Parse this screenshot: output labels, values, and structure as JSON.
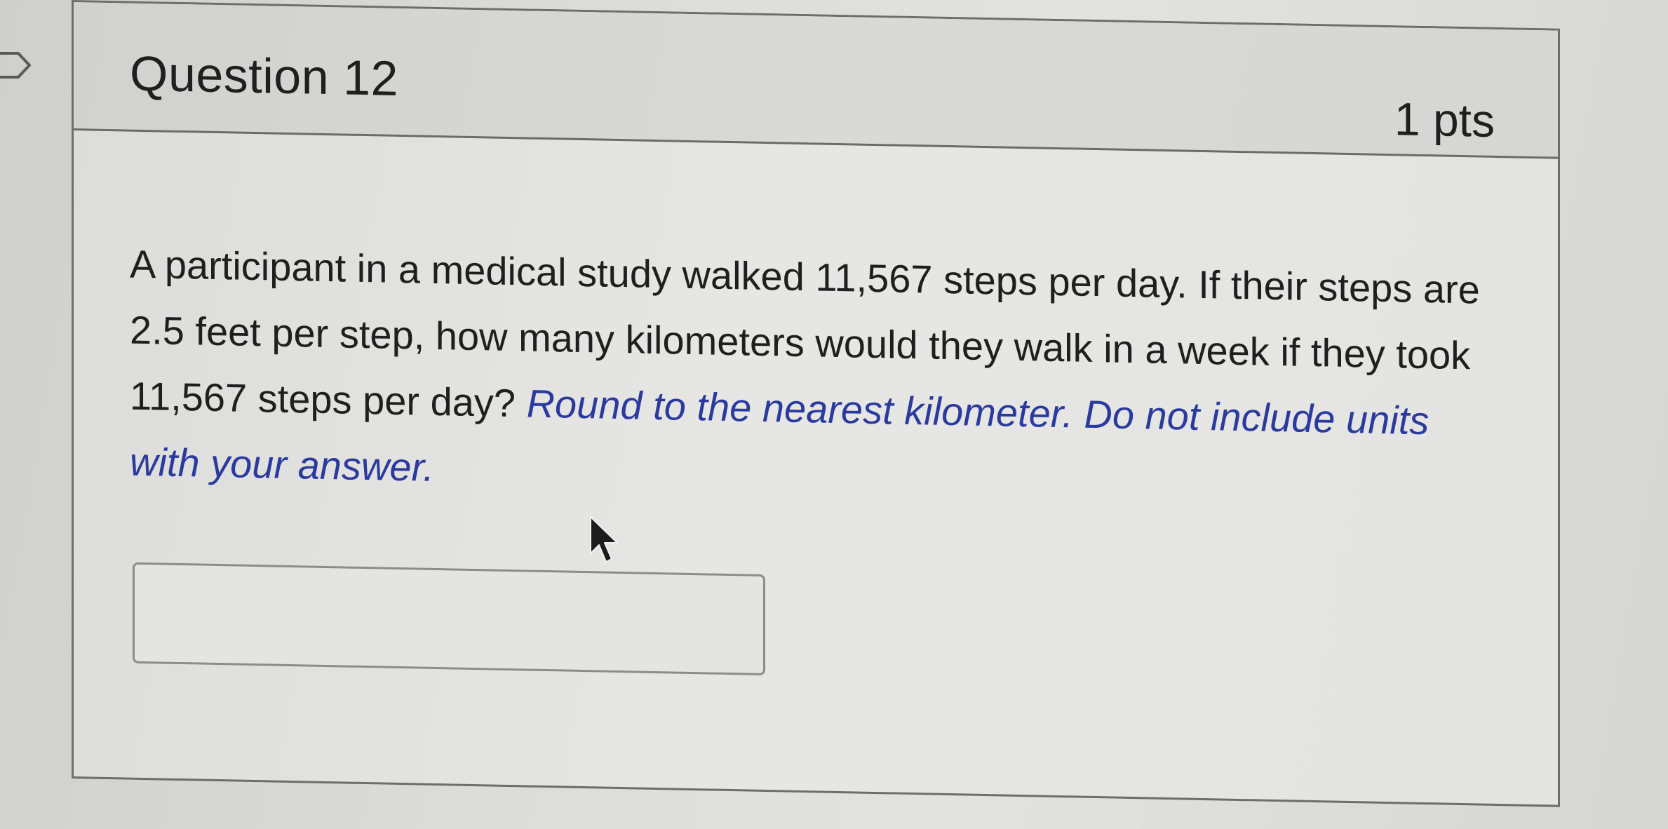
{
  "question": {
    "title": "Question 12",
    "points": "1 pts",
    "text": "A participant in a medical study walked 11,567 steps per day. If their steps are 2.5 feet per step, how many kilometers would they walk in a week if they took 11,567 steps per day?",
    "instruction": "Round to the nearest kilometer.  Do not include units with your answer.",
    "answer_value": ""
  },
  "icons": {
    "bookmark": "bookmark-icon",
    "cursor": "mouse-pointer-icon"
  },
  "colors": {
    "instruction_text": "#2b3a9e",
    "body_text": "#1f1f1f",
    "header_bg": "#d6d6d4",
    "border": "#6d6d6a"
  }
}
